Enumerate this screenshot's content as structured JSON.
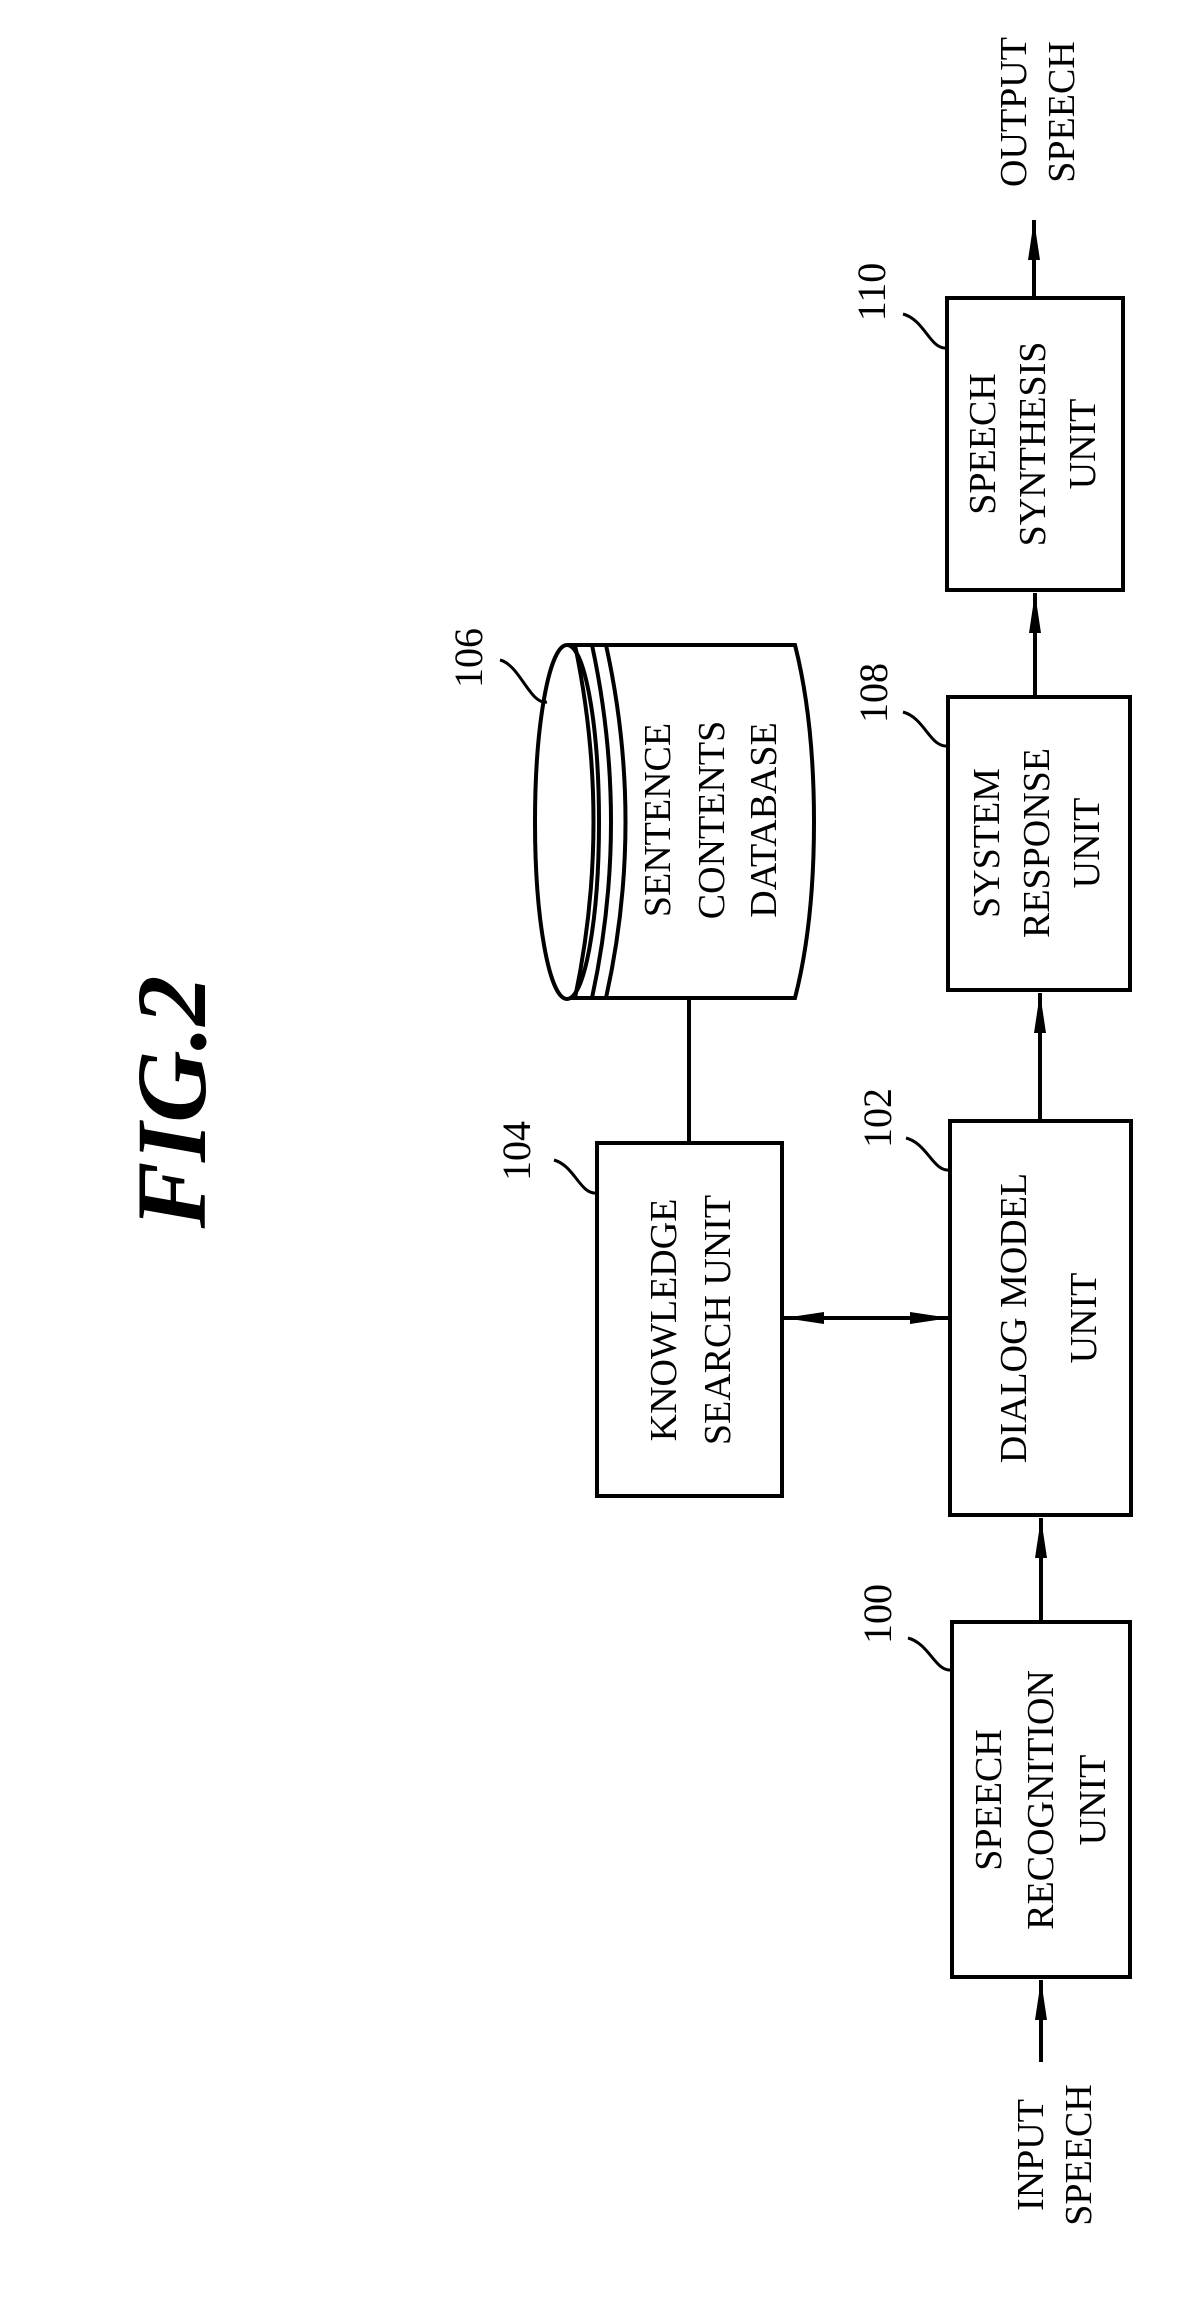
{
  "figure": {
    "title": "FIG.2",
    "orientation": "rotated 90° counter-clockwise"
  },
  "blocks": {
    "speech_recognition": {
      "ref": "100",
      "lines": [
        "SPEECH",
        "RECOGNITION",
        "UNIT"
      ]
    },
    "dialog_model": {
      "ref": "102",
      "lines": [
        "DIALOG MODEL",
        "UNIT"
      ]
    },
    "knowledge_search": {
      "ref": "104",
      "lines": [
        "KNOWLEDGE",
        "SEARCH UNIT"
      ]
    },
    "sentence_db": {
      "ref": "106",
      "lines": [
        "SENTENCE",
        "CONTENTS",
        "DATABASE"
      ]
    },
    "system_response": {
      "ref": "108",
      "lines": [
        "SYSTEM",
        "RESPONSE",
        "UNIT"
      ]
    },
    "speech_synthesis": {
      "ref": "110",
      "lines": [
        "SPEECH",
        "SYNTHESIS",
        "UNIT"
      ]
    }
  },
  "io": {
    "input": [
      "INPUT",
      "SPEECH"
    ],
    "output": [
      "OUTPUT",
      "SPEECH"
    ]
  },
  "connections": [
    {
      "from": "input",
      "to": "speech_recognition",
      "type": "arrow"
    },
    {
      "from": "speech_recognition",
      "to": "dialog_model",
      "type": "arrow"
    },
    {
      "from": "dialog_model",
      "to": "knowledge_search",
      "type": "bidirectional"
    },
    {
      "from": "knowledge_search",
      "to": "sentence_db",
      "type": "line"
    },
    {
      "from": "dialog_model",
      "to": "system_response",
      "type": "arrow"
    },
    {
      "from": "system_response",
      "to": "speech_synthesis",
      "type": "arrow"
    },
    {
      "from": "speech_synthesis",
      "to": "output",
      "type": "arrow"
    }
  ]
}
